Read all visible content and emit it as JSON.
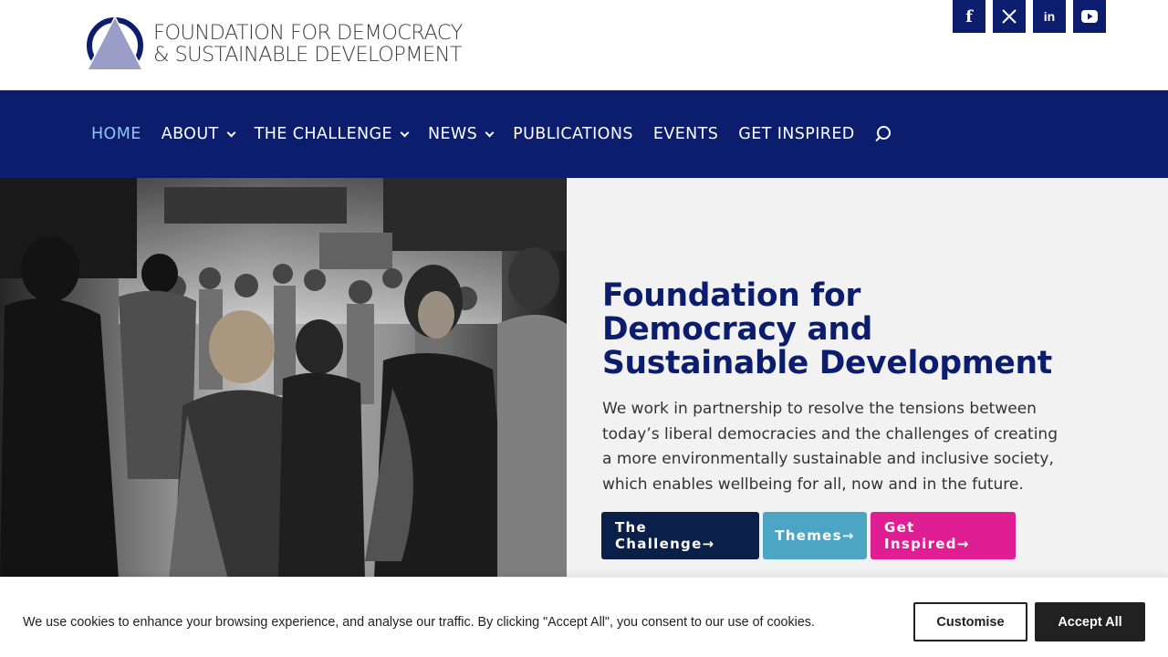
{
  "header": {
    "logo_line1": "FOUNDATION FOR DEMOCRACY",
    "logo_line2": "& SUSTAINABLE DEVELOPMENT",
    "social": [
      {
        "name": "facebook-icon",
        "glyph": "f"
      },
      {
        "name": "x-icon",
        "glyph": "𝕏"
      },
      {
        "name": "linkedin-icon",
        "glyph": "in"
      },
      {
        "name": "youtube-icon",
        "glyph": "▶"
      }
    ]
  },
  "nav": {
    "items": [
      {
        "label": "HOME",
        "active": true
      },
      {
        "label": "ABOUT"
      },
      {
        "label": "THE CHALLENGE"
      },
      {
        "label": "NEWS"
      },
      {
        "label": "PUBLICATIONS"
      },
      {
        "label": "EVENTS"
      },
      {
        "label": "GET INSPIRED"
      }
    ]
  },
  "hero": {
    "title": "Foundation for Democracy and Sustainable Development",
    "description": "We work in partnership to resolve the tensions between today’s liberal democracies and the challenges of creating a more environmentally sustainable and inclusive society, which enables wellbeing for all, now and in the future.",
    "buttons": {
      "challenge": "The Challenge→",
      "themes": "Themes→",
      "inspired": "Get Inspired→"
    }
  },
  "cookie": {
    "text": "We use cookies to enhance your browsing experience, and analyse our traffic. By clicking \"Accept All\", you consent to our use of cookies.",
    "customise": "Customise",
    "accept": "Accept All"
  },
  "colors": {
    "brand_navy": "#0d1d6d",
    "nav_active": "#8fc6f0",
    "btn_dark": "#0b2049",
    "btn_teal": "#4ca5c3",
    "btn_pink": "#e01e94"
  }
}
